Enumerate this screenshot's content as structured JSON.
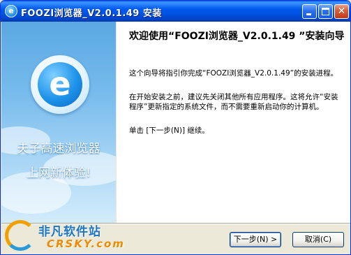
{
  "window": {
    "title": "FOOZI浏览器_V2.0.1.49 安装",
    "icon_letter": "e",
    "controls": {
      "minimize": "minimize-icon",
      "maximize": "maximize-icon",
      "close": "✕"
    }
  },
  "banner": {
    "logo_letter": "e",
    "line1": "夫子高速浏览器",
    "line2": "上网新体验!"
  },
  "content": {
    "heading": "欢迎使用“FOOZI浏览器_V2.0.1.49 ”安装向导",
    "paragraph1": "这个向导将指引你完成“FOOZI浏览器_V2.0.1.49”的安装进程。",
    "paragraph2": "在开始安装之前，建议先关闭其他所有应用程序。这将允许“安装程序”更新指定的系统文件，而不需要重新启动你的计算机。",
    "paragraph3": "单击 [下一步(N)] 继续。"
  },
  "buttons": {
    "next": "下一步(N) >",
    "cancel": "取消(C)"
  },
  "watermark": {
    "cn": "非凡软件站",
    "en": "CRSKY.com"
  },
  "colors": {
    "titlebar": "#0054e3",
    "banner_top": "#5aa8e3",
    "window_bg": "#ece9d8"
  }
}
